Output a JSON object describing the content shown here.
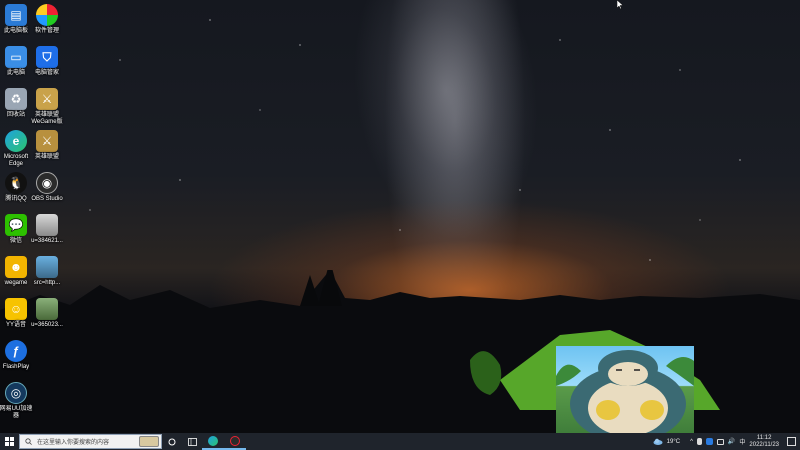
{
  "desktop": {
    "icons": [
      {
        "label": "此电脑板",
        "icon": "control-panel-icon"
      },
      {
        "label": "软件管理",
        "icon": "software-manager-icon"
      },
      {
        "label": "此电脑",
        "icon": "this-pc-icon"
      },
      {
        "label": "电脑管家",
        "icon": "pc-manager-icon"
      },
      {
        "label": "回收站",
        "icon": "recycle-bin-icon"
      },
      {
        "label": "英雄联盟\nWeGame版",
        "icon": "lol-wegame-icon"
      },
      {
        "label": "Microsoft\nEdge",
        "icon": "edge-icon"
      },
      {
        "label": "英雄联盟",
        "icon": "lol-icon"
      },
      {
        "label": "腾讯QQ",
        "icon": "qq-icon"
      },
      {
        "label": "OBS Studio",
        "icon": "obs-icon"
      },
      {
        "label": "微信",
        "icon": "wechat-icon"
      },
      {
        "label": "u=384621...",
        "icon": "image-file-icon"
      },
      {
        "label": "wegame",
        "icon": "wegame-icon"
      },
      {
        "label": "src=http...",
        "icon": "image-file-icon"
      },
      {
        "label": "YY语音",
        "icon": "yy-icon"
      },
      {
        "label": "u=365023...",
        "icon": "image-file-icon"
      },
      {
        "label": "FlashPlay",
        "icon": "flash-icon"
      },
      {
        "label": "网易UU加速\n器",
        "icon": "uu-booster-icon"
      }
    ]
  },
  "taskbar": {
    "search_placeholder": "在这里输入你要搜索的内容",
    "weather_temp": "19°C",
    "ime": "中",
    "time": "11:12",
    "date": "2022/11/23"
  },
  "colors": {
    "taskbar_bg": "#1f242c",
    "accent": "#0078d4"
  }
}
